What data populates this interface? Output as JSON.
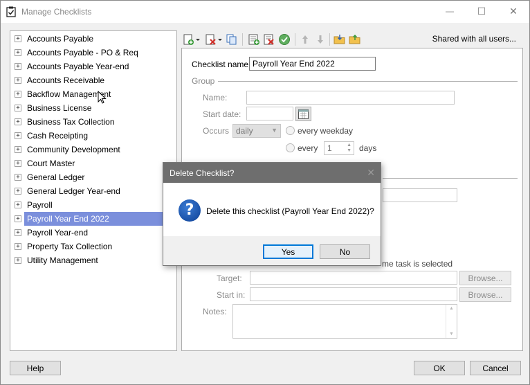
{
  "window": {
    "title": "Manage Checklists",
    "controls": {
      "minimize": "—",
      "maximize": "☐",
      "close": "✕"
    }
  },
  "tree": {
    "items": [
      "Accounts Payable",
      "Accounts Payable - PO & Req",
      "Accounts Payable Year-end",
      "Accounts Receivable",
      "Backflow Management",
      "Business License",
      "Business Tax Collection",
      "Cash Receipting",
      "Community Development",
      "Court Master",
      "General Ledger",
      "General Ledger Year-end",
      "Payroll",
      "Payroll Year End 2022",
      "Payroll Year-end",
      "Property Tax Collection",
      "Utility Management"
    ],
    "selected_index": 13,
    "expander": "+"
  },
  "toolbar": {
    "shared_label": "Shared with all users..."
  },
  "form": {
    "checklist_name_label": "Checklist name:",
    "checklist_name_value": "Payroll Year End 2022",
    "group_label": "Group",
    "name_label": "Name:",
    "start_date_label": "Start date:",
    "occurs_label": "Occurs",
    "occurs_value": "daily",
    "every_weekday_label": "every weekday",
    "every_label": "every",
    "every_value": "1",
    "days_label": "days",
    "task_selected_text": "me task is selected",
    "target_label": "Target:",
    "start_in_label": "Start in:",
    "browse_label": "Browse...",
    "notes_label": "Notes:"
  },
  "dialog": {
    "title": "Delete Checklist?",
    "close": "✕",
    "icon": "?",
    "message": "Delete this checklist (Payroll Year End 2022)?",
    "yes_label": "Yes",
    "no_label": "No"
  },
  "footer": {
    "help_label": "Help",
    "ok_label": "OK",
    "cancel_label": "Cancel"
  }
}
